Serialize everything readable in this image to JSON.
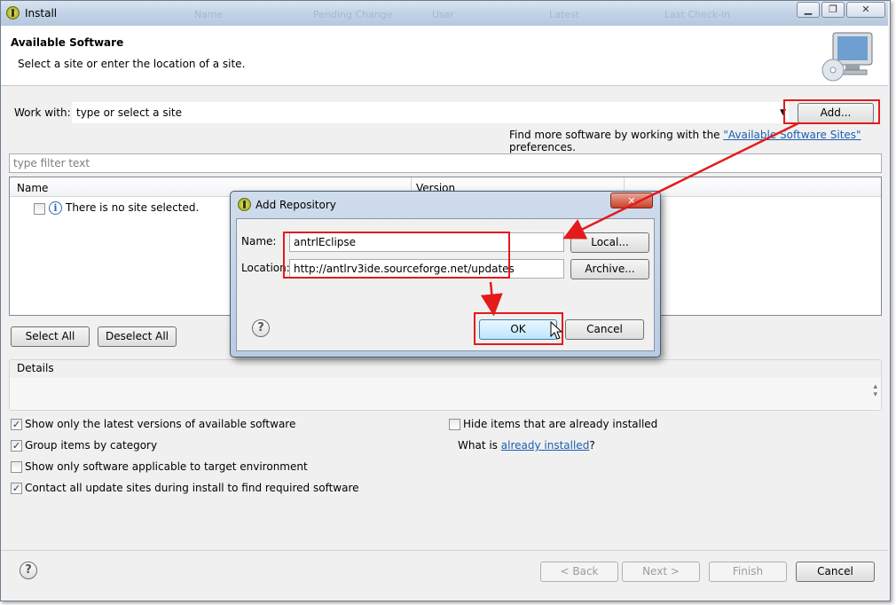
{
  "window": {
    "title": "Install",
    "ghost_tabs": [
      "Name",
      "Pending Change",
      "User",
      "Latest",
      "Last Check-in"
    ]
  },
  "header": {
    "title": "Available Software",
    "subtitle": "Select a site or enter the location of a site."
  },
  "work_with": {
    "label": "Work with:",
    "value": "type or select a site",
    "add_label": "Add...",
    "find_more_prefix": "Find more software by working with the",
    "find_more_link": "\"Available Software Sites\"",
    "find_more_suffix": "preferences."
  },
  "filter": {
    "placeholder": "type filter text"
  },
  "table": {
    "columns": [
      "Name",
      "Version"
    ],
    "empty_message": "There is no site selected."
  },
  "buttons": {
    "select_all": "Select All",
    "deselect_all": "Deselect All"
  },
  "details": {
    "label": "Details"
  },
  "options": [
    {
      "label": "Show only the latest versions of available software",
      "checked": true
    },
    {
      "label": "Group items by category",
      "checked": true
    },
    {
      "label": "Show only software applicable to target environment",
      "checked": false
    },
    {
      "label": "Contact all update sites during install to find required software",
      "checked": true
    }
  ],
  "hide_installed": {
    "label": "Hide items that are already installed",
    "checked": false
  },
  "what_is": {
    "prefix": "What is",
    "link": "already installed",
    "suffix": "?"
  },
  "footer": {
    "back": "< Back",
    "next": "Next >",
    "finish": "Finish",
    "cancel": "Cancel"
  },
  "dialog": {
    "title": "Add Repository",
    "name_label": "Name:",
    "name_value": "antrlEclipse",
    "location_label": "Location:",
    "location_value": "http://antlrv3ide.sourceforge.net/updates",
    "local_label": "Local...",
    "archive_label": "Archive...",
    "ok_label": "OK",
    "cancel_label": "Cancel",
    "close_symbol": "✕"
  },
  "colors": {
    "annotation": "#e31b1b",
    "link": "#1c5eb0"
  }
}
